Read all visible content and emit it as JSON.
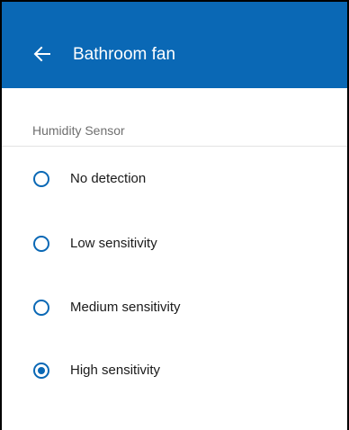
{
  "header": {
    "back_icon": "arrow-left-icon",
    "title": "Bathroom fan",
    "background_color": "#0a68b5"
  },
  "section": {
    "label": "Humidity Sensor"
  },
  "options": [
    {
      "label": "No detection",
      "selected": false
    },
    {
      "label": "Low sensitivity",
      "selected": false
    },
    {
      "label": "Medium sensitivity",
      "selected": false
    },
    {
      "label": "High sensitivity",
      "selected": true
    }
  ],
  "accent_color": "#0a68b5"
}
